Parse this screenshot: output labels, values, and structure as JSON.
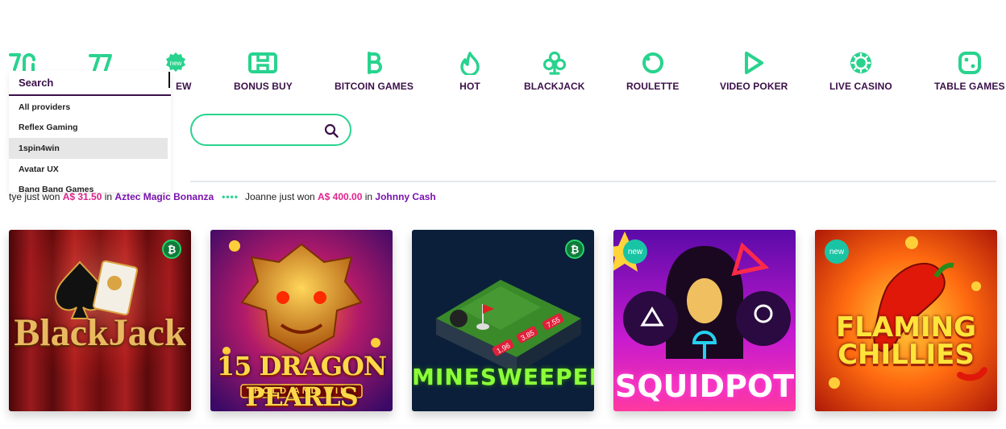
{
  "nav": {
    "items": [
      {
        "label": "",
        "icon": "seven-icon"
      },
      {
        "label": "",
        "icon": "slots-77-icon"
      },
      {
        "label": "EW",
        "icon": "new-badge-icon",
        "badge": "new"
      },
      {
        "label": "BONUS BUY",
        "icon": "bonus-buy-icon"
      },
      {
        "label": "BITCOIN GAMES",
        "icon": "bitcoin-icon"
      },
      {
        "label": "HOT",
        "icon": "flame-icon"
      },
      {
        "label": "BLACKJACK",
        "icon": "club-icon"
      },
      {
        "label": "ROULETTE",
        "icon": "roulette-icon"
      },
      {
        "label": "VIDEO POKER",
        "icon": "play-icon"
      },
      {
        "label": "LIVE CASINO",
        "icon": "live-casino-icon"
      },
      {
        "label": "TABLE GAMES",
        "icon": "dice-icon"
      }
    ]
  },
  "provider_dropdown": {
    "search_label": "Search",
    "items": [
      "All providers",
      "Reflex Gaming",
      "1spin4win",
      "Avatar UX",
      "Bang Bang Games"
    ],
    "selected": "1spin4win"
  },
  "search": {
    "placeholder": ""
  },
  "ticker": {
    "win1": {
      "prefix": "tye just won ",
      "amount": "A$ 31.50",
      "mid": " in ",
      "game": "Aztec Magic Bonanza"
    },
    "separator": "••••",
    "win2": {
      "prefix": "Joanne just won ",
      "amount": "A$ 400.00",
      "mid": " in ",
      "game": "Johnny Cash"
    }
  },
  "games": [
    {
      "title": "BlackJack",
      "badge": "bitcoin"
    },
    {
      "title": "15 DRAGON PEARLS",
      "subtitle": "HOLD AND WIN",
      "badge": ""
    },
    {
      "title": "MINESWEEPER",
      "badge": "bitcoin",
      "multipliers": [
        "1.96",
        "3.85",
        "7.55"
      ]
    },
    {
      "title": "SQUIDPOT",
      "badge": "new"
    },
    {
      "title": "FLAMING CHILLIES",
      "badge": "new"
    }
  ],
  "badge_text": {
    "new": "new",
    "bitcoin": "₿"
  },
  "colors": {
    "brand_dark": "#3a1048",
    "accent_green": "#29d38e",
    "amount_pink": "#e0248c",
    "game_purple": "#7a12b0"
  }
}
